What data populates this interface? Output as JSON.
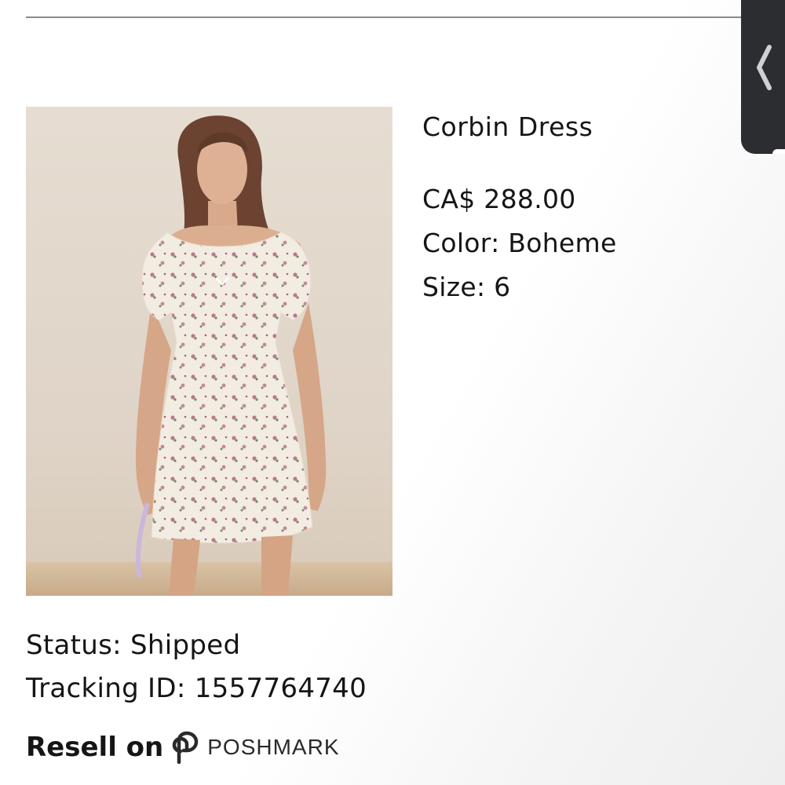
{
  "product": {
    "title": "Corbin Dress",
    "price": "CA$ 288.00",
    "color": "Color: Boheme",
    "size": "Size: 6",
    "image_alt": "model wearing floral mini dress"
  },
  "order": {
    "status": "Status: Shipped",
    "tracking": "Tracking ID: 1557764740"
  },
  "resell": {
    "label": "Resell on",
    "brand": "POSHMARK"
  },
  "colors": {
    "text": "#151515",
    "divider": "#8a8a8a",
    "side_tab": "#2b2d31"
  },
  "icons": {
    "side_tab": "chevron-left-icon",
    "brand": "poshmark-logo-icon"
  }
}
